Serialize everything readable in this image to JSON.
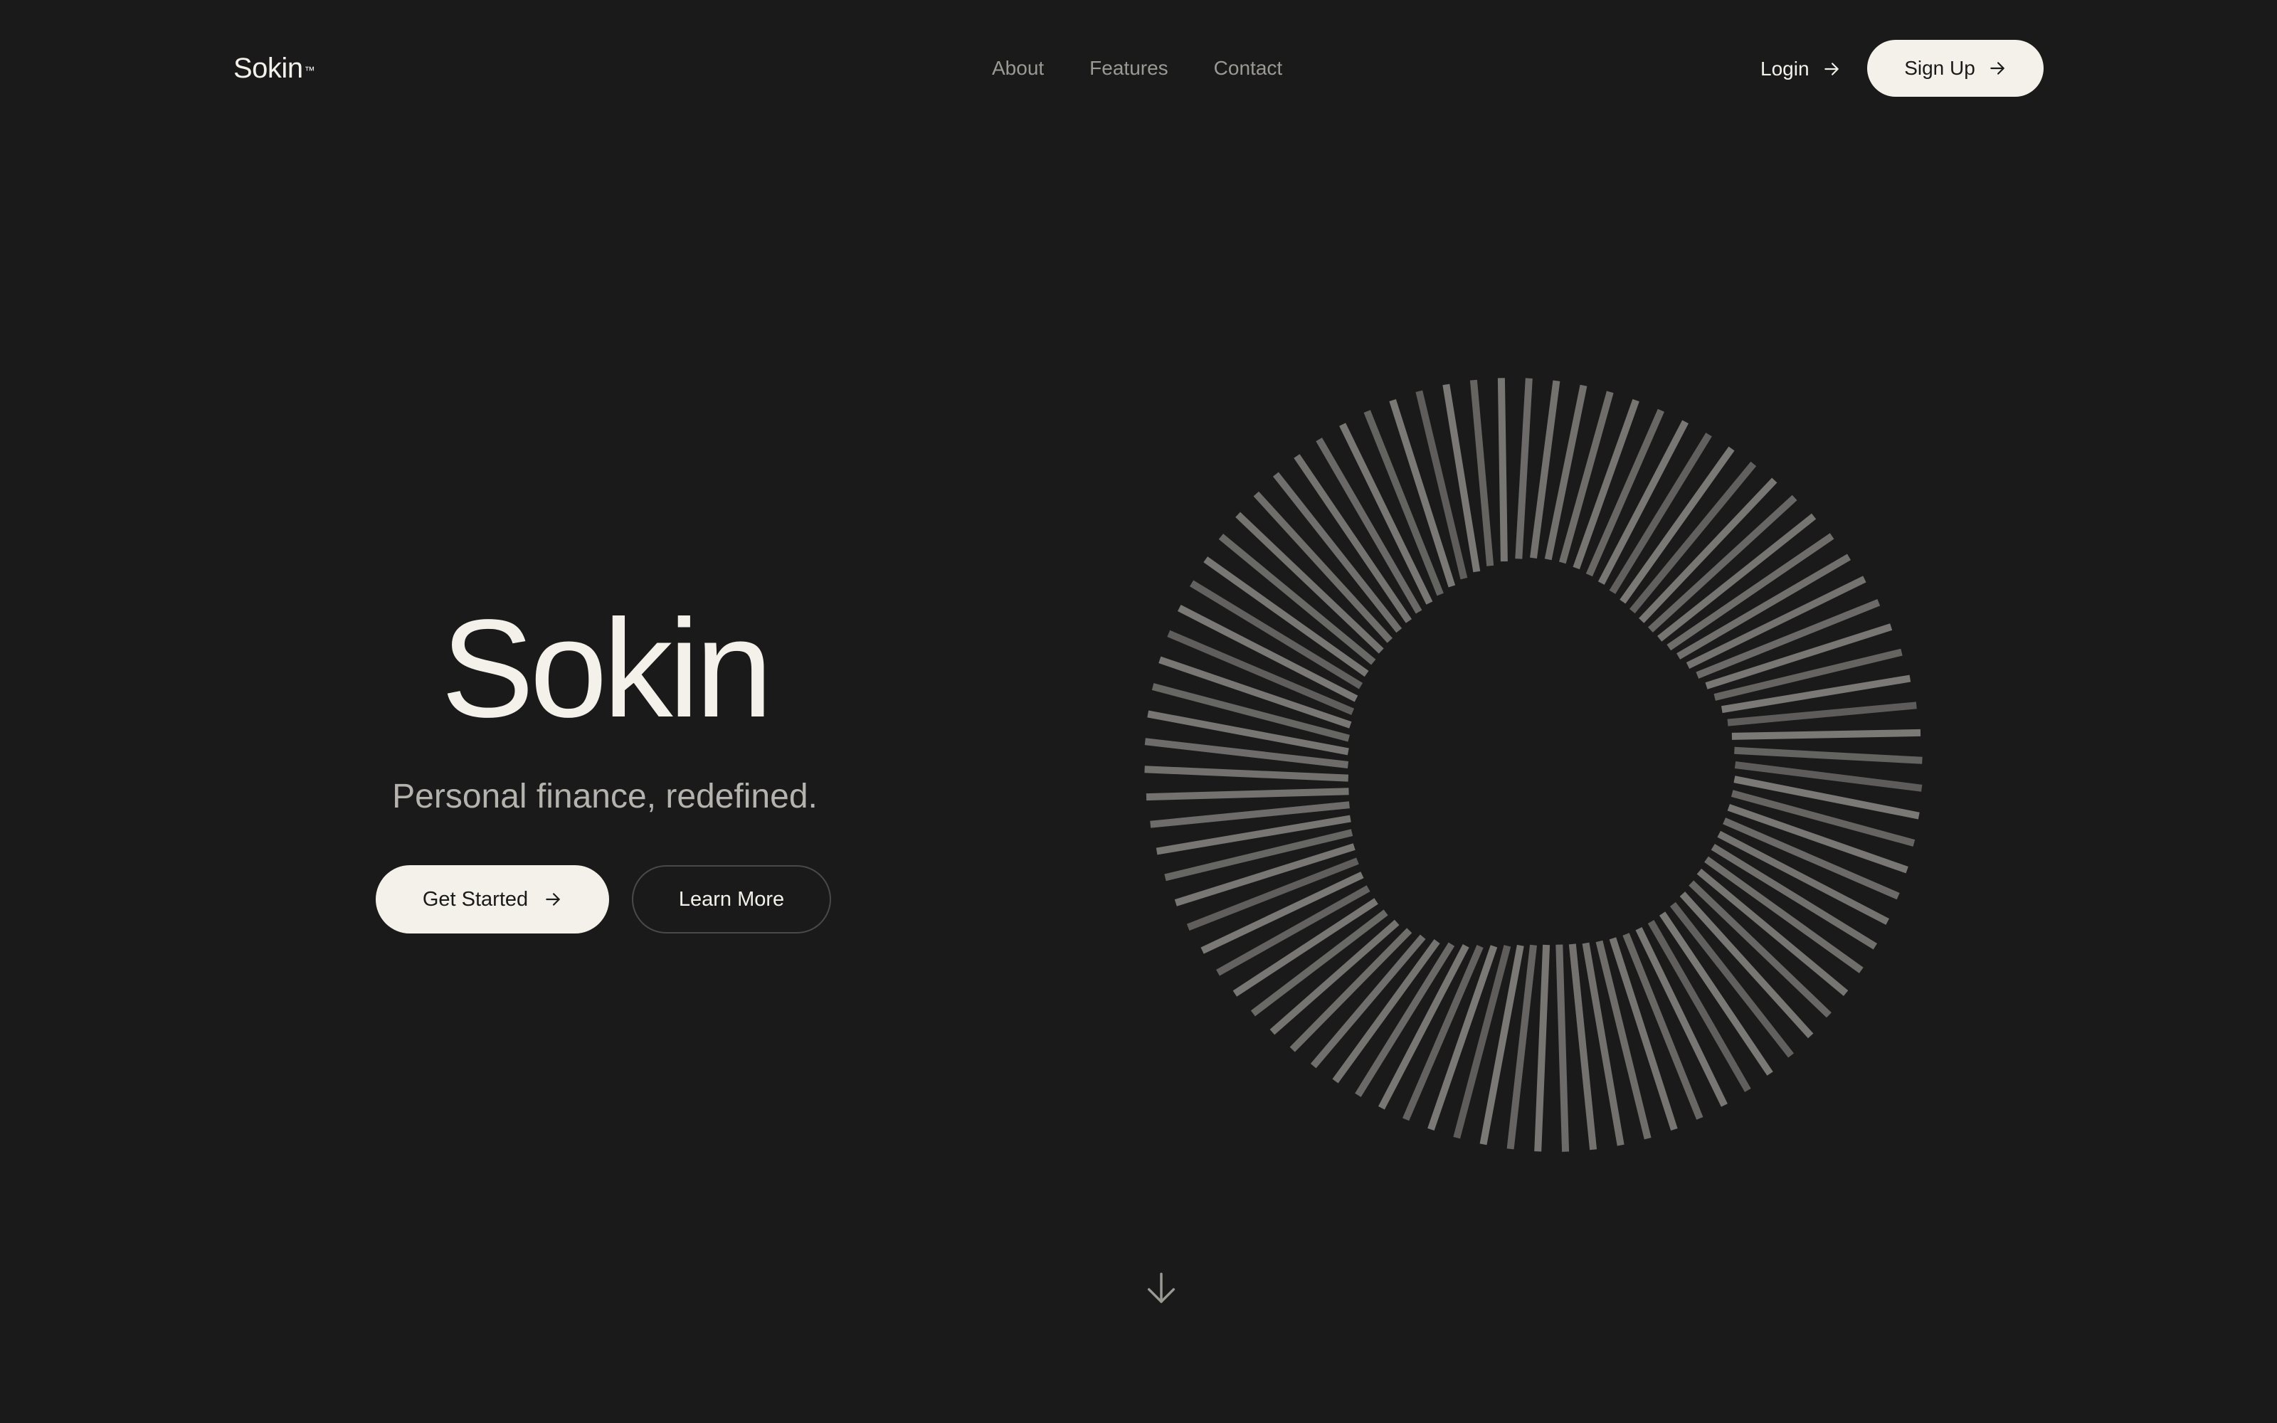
{
  "header": {
    "logo": "Sokin",
    "logo_mark": "™",
    "nav": [
      "About",
      "Features",
      "Contact"
    ],
    "login_label": "Login",
    "signup_label": "Sign Up",
    "arrow_icon": "arrow-right-icon"
  },
  "hero": {
    "title": "Sokin",
    "subtitle": "Personal finance, redefined.",
    "primary_button": "Get Started",
    "secondary_button": "Learn More"
  },
  "graphic": {
    "type": "radial-bars",
    "bar_count": 88,
    "color": "#7a7976"
  },
  "scroll": {
    "icon": "arrow-down-icon"
  },
  "colors": {
    "background": "#1a1a1a",
    "foreground": "#f3f1ea",
    "muted": "#9b9994"
  }
}
